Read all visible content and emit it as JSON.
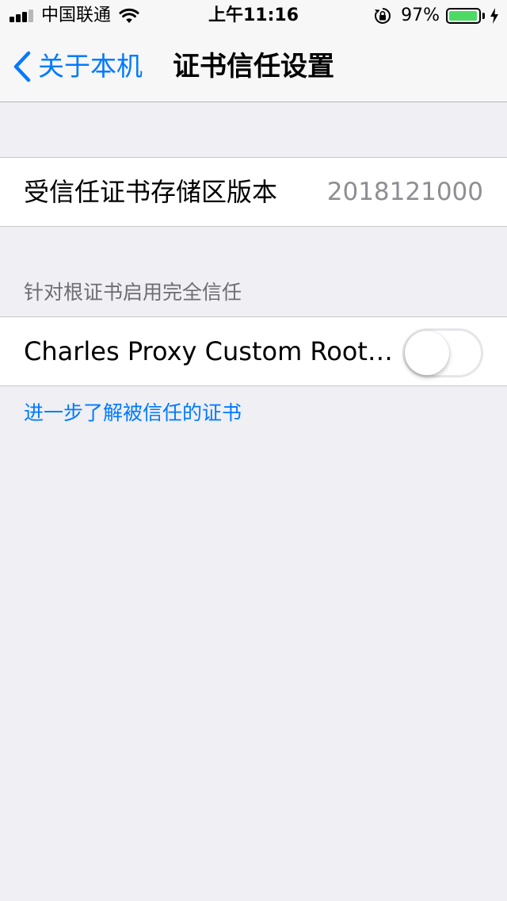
{
  "status_bar": {
    "carrier": "中国联通",
    "time": "上午11:16",
    "battery_percent_label": "97%",
    "battery_level": 0.97,
    "signal_bars_filled": 3,
    "signal_bars_total": 4,
    "icons": [
      "signal-bars-icon",
      "wifi-icon",
      "orientation-lock-icon",
      "battery-icon",
      "charging-bolt-icon"
    ]
  },
  "nav": {
    "back_label": "关于本机",
    "title": "证书信任设置",
    "back_icon": "chevron-left-icon"
  },
  "version_cell": {
    "label": "受信任证书存储区版本",
    "value": "2018121000"
  },
  "trust_section": {
    "header": "针对根证书启用完全信任",
    "items": [
      {
        "label": "Charles Proxy Custom Root C...",
        "enabled": false
      }
    ],
    "footer_link": "进一步了解被信任的证书"
  },
  "colors": {
    "accent": "#007aff",
    "background": "#efeff4",
    "battery_fill": "#4cd964",
    "secondary_text": "#8e8e93",
    "section_header_text": "#6d6d72"
  }
}
